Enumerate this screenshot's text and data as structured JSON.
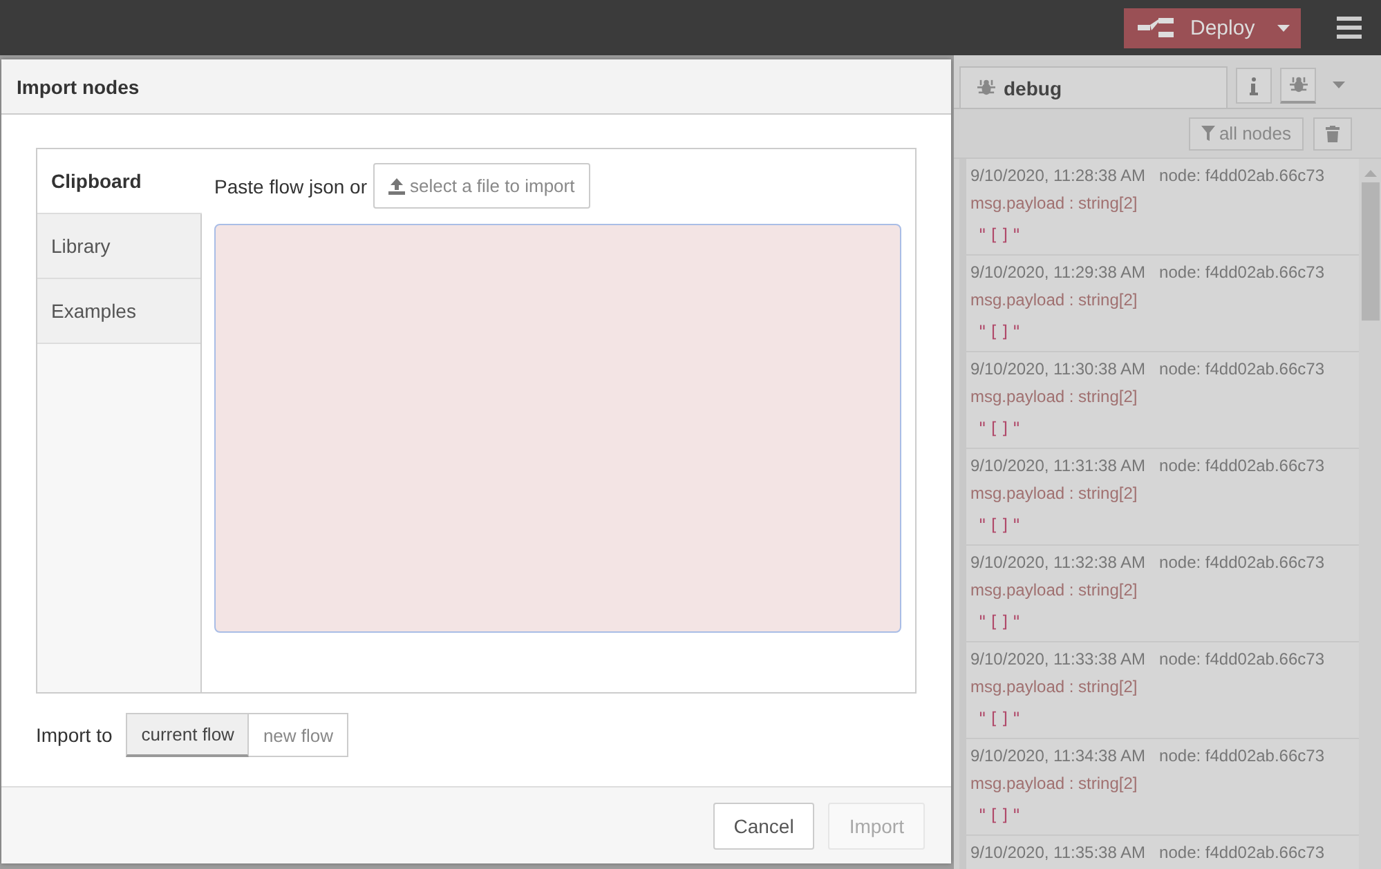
{
  "header": {
    "deploy": {
      "label": "Deploy"
    }
  },
  "dialog": {
    "title": "Import nodes",
    "tabs": [
      {
        "label": "Clipboard",
        "selected": true
      },
      {
        "label": "Library",
        "selected": false
      },
      {
        "label": "Examples",
        "selected": false
      }
    ],
    "paste_label": "Paste flow json or",
    "file_button": "select a file to import",
    "import_to": {
      "label": "Import to",
      "options": [
        {
          "label": "current flow",
          "selected": true
        },
        {
          "label": "new flow",
          "selected": false
        }
      ]
    },
    "buttons": [
      {
        "label": "Cancel",
        "disabled": false
      },
      {
        "label": "Import",
        "disabled": true
      }
    ]
  },
  "sidebar": {
    "tab": "debug",
    "filter_button": "all nodes",
    "messages": [
      {
        "time": "9/10/2020, 11:28:38 AM",
        "node": "node: f4dd02ab.66c73",
        "type": "msg.payload : string[2]",
        "value": "\"[]\""
      },
      {
        "time": "9/10/2020, 11:29:38 AM",
        "node": "node: f4dd02ab.66c73",
        "type": "msg.payload : string[2]",
        "value": "\"[]\""
      },
      {
        "time": "9/10/2020, 11:30:38 AM",
        "node": "node: f4dd02ab.66c73",
        "type": "msg.payload : string[2]",
        "value": "\"[]\""
      },
      {
        "time": "9/10/2020, 11:31:38 AM",
        "node": "node: f4dd02ab.66c73",
        "type": "msg.payload : string[2]",
        "value": "\"[]\""
      },
      {
        "time": "9/10/2020, 11:32:38 AM",
        "node": "node: f4dd02ab.66c73",
        "type": "msg.payload : string[2]",
        "value": "\"[]\""
      },
      {
        "time": "9/10/2020, 11:33:38 AM",
        "node": "node: f4dd02ab.66c73",
        "type": "msg.payload : string[2]",
        "value": "\"[]\""
      },
      {
        "time": "9/10/2020, 11:34:38 AM",
        "node": "node: f4dd02ab.66c73",
        "type": "msg.payload : string[2]",
        "value": "\"[]\""
      },
      {
        "time": "9/10/2020, 11:35:38 AM",
        "node": "node: f4dd02ab.66c73"
      }
    ]
  }
}
